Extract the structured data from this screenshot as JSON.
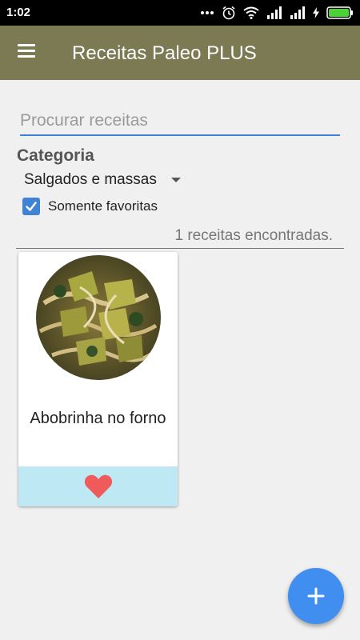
{
  "status_bar": {
    "time": "1:02"
  },
  "app_bar": {
    "title": "Receitas Paleo PLUS",
    "menu_icon": "menu-icon"
  },
  "search": {
    "placeholder": "Procurar receitas",
    "value": ""
  },
  "filters": {
    "category_label": "Categoria",
    "category_value": "Salgados e massas",
    "favorites_label": "Somente favoritas",
    "favorites_checked": true
  },
  "results": {
    "count_text": "1 receitas encontradas."
  },
  "recipes": [
    {
      "title": "Abobrinha no forno",
      "favorite": true,
      "favorite_icon": "heart-icon"
    }
  ],
  "fab": {
    "icon": "plus-icon"
  },
  "colors": {
    "app_bar": "#7b7a52",
    "accent": "#3f83d6",
    "fab": "#3f8ef0",
    "card_footer": "#bfe8f5",
    "heart": "#ef5a5a"
  }
}
